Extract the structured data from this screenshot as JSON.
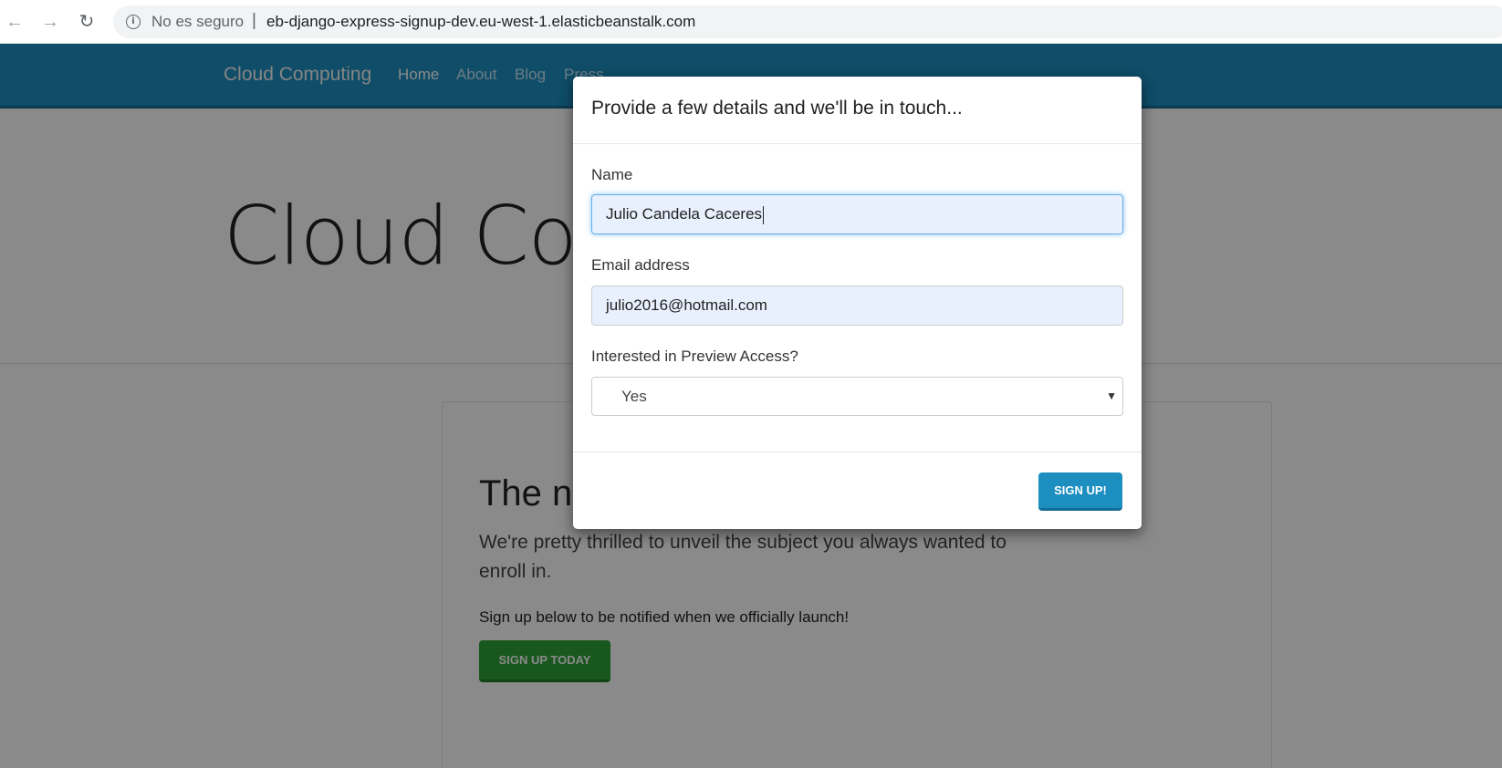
{
  "browser": {
    "security_label": "No es seguro",
    "separator": "|",
    "url": "eb-django-express-signup-dev.eu-west-1.elasticbeanstalk.com"
  },
  "navbar": {
    "brand": "Cloud Computing",
    "links": [
      {
        "label": "Home",
        "active": true
      },
      {
        "label": "About",
        "active": false
      },
      {
        "label": "Blog",
        "active": false
      },
      {
        "label": "Press",
        "active": false
      }
    ]
  },
  "hero": {
    "title": "Cloud Com"
  },
  "card": {
    "title": "The n",
    "lead": "We're pretty thrilled to unveil the subject you always wanted to enroll in.",
    "text": "Sign up below to be notified when we officially launch!",
    "button_label": "Sign up today"
  },
  "modal": {
    "title": "Provide a few details and we'll be in touch...",
    "name_label": "Name",
    "name_value": "Julio Candela Caceres",
    "email_label": "Email address",
    "email_value": "julio2016@hotmail.com",
    "preview_label": "Interested in Preview Access?",
    "preview_value": "Yes",
    "submit_label": "Sign up!"
  },
  "colors": {
    "navbar": "#1c8fc0",
    "primary_button": "#1c8fc0",
    "success_button": "#2da137",
    "autofill": "#e8f0fe"
  }
}
